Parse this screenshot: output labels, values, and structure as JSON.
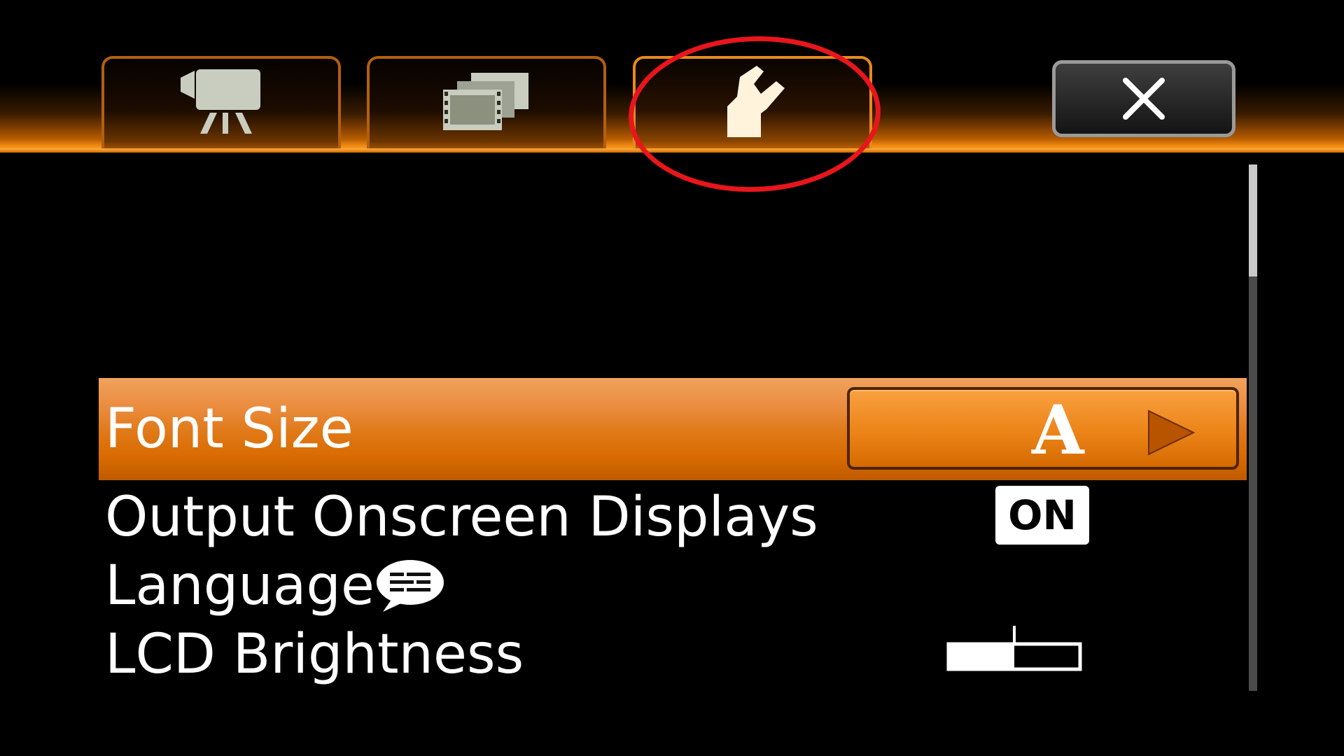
{
  "tabs": [
    {
      "name": "camera",
      "icon": "movie-camera-icon",
      "active": false
    },
    {
      "name": "playback",
      "icon": "film-frames-icon",
      "active": false
    },
    {
      "name": "setup",
      "icon": "wrench-icon",
      "active": true
    }
  ],
  "close_icon": "close-icon",
  "menu": {
    "items": [
      {
        "label": "Font Size",
        "value": "A",
        "selected": true
      },
      {
        "label": "Output Onscreen Displays",
        "value": "ON",
        "selected": false
      },
      {
        "label": "Language",
        "icon": "speech-bubble-icon",
        "selected": false
      },
      {
        "label": "LCD Brightness",
        "level": 0.5,
        "selected": false
      }
    ]
  },
  "colors": {
    "accent": "#e07a18",
    "annotation_ring": "#e8161c"
  }
}
